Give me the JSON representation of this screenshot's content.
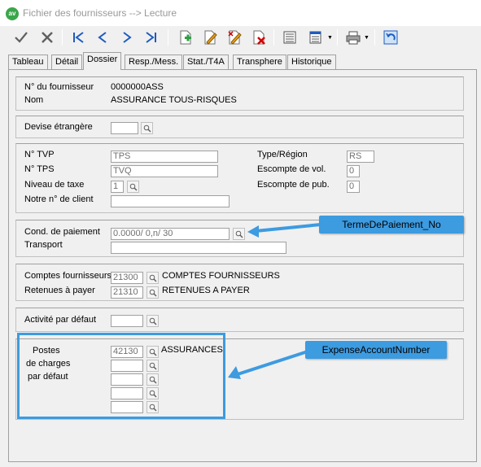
{
  "window": {
    "app_icon": "av",
    "title": "Fichier des fournisseurs  --> Lecture"
  },
  "toolbar": [
    {
      "name": "check-icon"
    },
    {
      "name": "cancel-x-icon"
    },
    {
      "name": "first-record-icon"
    },
    {
      "name": "previous-record-icon"
    },
    {
      "name": "next-record-icon"
    },
    {
      "name": "last-record-icon"
    },
    {
      "name": "add-record-icon"
    },
    {
      "name": "edit-record-icon"
    },
    {
      "name": "copy-edit-icon"
    },
    {
      "name": "delete-record-icon"
    },
    {
      "name": "list-view-icon"
    },
    {
      "name": "detail-view-icon"
    },
    {
      "name": "print-icon"
    },
    {
      "name": "undo-icon"
    }
  ],
  "tabs": [
    "Tableau",
    "Détail",
    "Dossier",
    "Resp./Mess.",
    "Stat./T4A",
    "Transphere",
    "Historique"
  ],
  "active_tab": "Dossier",
  "supplier": {
    "number_label": "N° du fournisseur",
    "number": "0000000ASS",
    "name_label": "Nom",
    "name": "ASSURANCE TOUS-RISQUES"
  },
  "currency": {
    "label": "Devise étrangère",
    "value": ""
  },
  "taxes": {
    "tvp_label": "N° TVP",
    "tvp": "TPS",
    "tps_label": "N° TPS",
    "tps": "TVQ",
    "level_label": "Niveau de taxe",
    "level": "1",
    "client_no_label": "Notre n° de client",
    "client_no": "",
    "type_region_label": "Type/Région",
    "type_region": "RS",
    "vol_discount_label": "Escompte de vol.",
    "vol_discount": "0",
    "pub_discount_label": "Escompte de pub.",
    "pub_discount": "0"
  },
  "payment": {
    "terms_label": "Cond. de paiement",
    "terms": "0.0000/  0,n/ 30",
    "transport_label": "Transport",
    "transport": ""
  },
  "accounts": {
    "suppliers_label": "Comptes fournisseurs",
    "suppliers_code": "21300",
    "suppliers_name": "COMPTES FOURNISSEURS",
    "holdbacks_label": "Retenues à payer",
    "holdbacks_code": "21310",
    "holdbacks_name": "RETENUES A PAYER"
  },
  "activity": {
    "label": "Activité par défaut",
    "value": ""
  },
  "expense": {
    "label_line1": "Postes",
    "label_line2": "de charges",
    "label_line3": "par défaut",
    "code1": "42130",
    "name1": "ASSURANCES"
  },
  "callouts": {
    "terms": "TermeDePaiement_No",
    "expense": "ExpenseAccountNumber"
  },
  "colors": {
    "callout": "#3d9be0",
    "accent_icon": "#1e5bbf"
  }
}
